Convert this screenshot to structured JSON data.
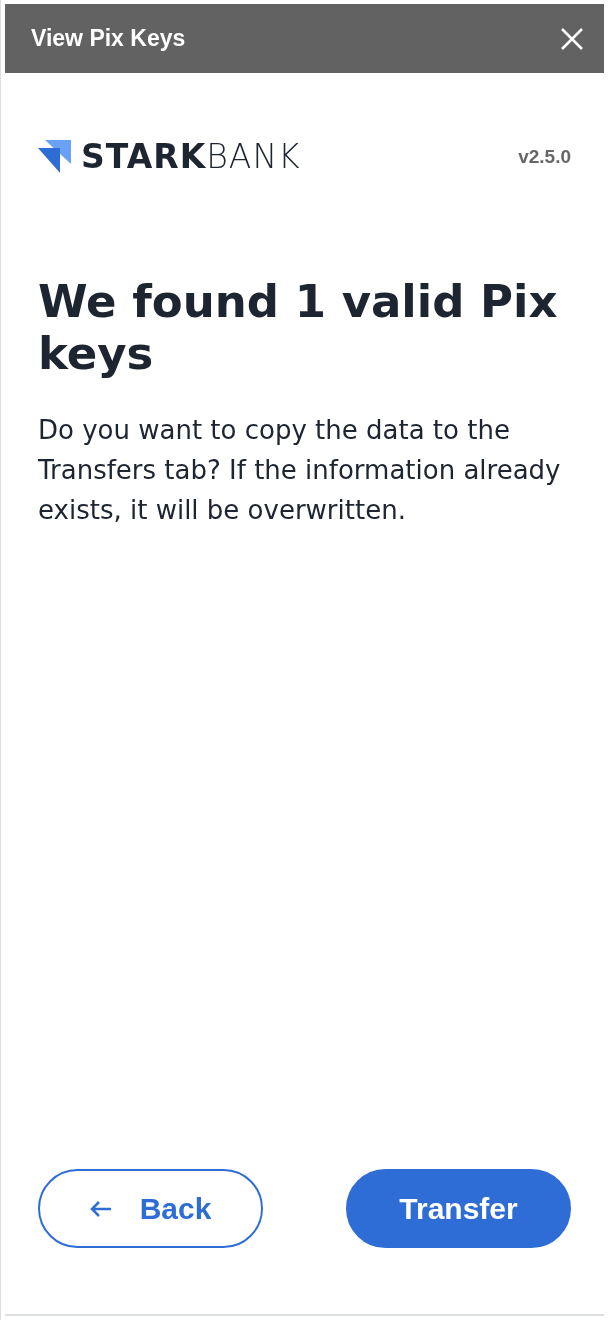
{
  "dialog": {
    "title": "View Pix Keys"
  },
  "brand": {
    "wordmark": "**STARK**BANK",
    "version": "v2.5.0"
  },
  "heading": "We found 1 valid Pix keys",
  "message": "Do you want to copy the data to the Transfers tab? If the information already exists, it will be overwritten.",
  "buttons": [
    {
      "kind": "back",
      "label": "Back"
    },
    {
      "kind": "primary",
      "label": "Transfer"
    }
  ]
}
